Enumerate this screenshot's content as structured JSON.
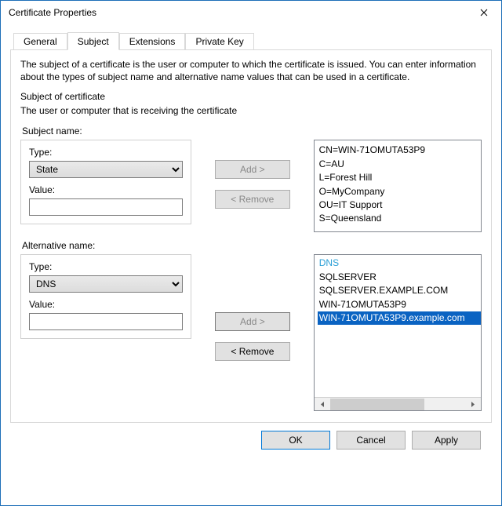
{
  "window": {
    "title": "Certificate Properties"
  },
  "tabs": {
    "general": "General",
    "subject": "Subject",
    "extensions": "Extensions",
    "privateKey": "Private Key"
  },
  "panel": {
    "description": "The subject of a certificate is the user or computer to which the certificate is issued. You can enter information about the types of subject name and alternative name values that can be used in a certificate.",
    "sectionTitle": "Subject of certificate",
    "sectionSub": "The user or computer that is receiving the certificate"
  },
  "subjectName": {
    "groupLabel": "Subject name:",
    "typeLabel": "Type:",
    "typeValue": "State",
    "valueLabel": "Value:",
    "valueValue": "",
    "addLabel": "Add >",
    "removeLabel": "< Remove",
    "list": [
      "CN=WIN-71OMUTA53P9",
      "C=AU",
      "L=Forest Hill",
      "O=MyCompany",
      "OU=IT Support",
      "S=Queensland"
    ]
  },
  "altName": {
    "groupLabel": "Alternative name:",
    "typeLabel": "Type:",
    "typeValue": "DNS",
    "valueLabel": "Value:",
    "valueValue": "",
    "addLabel": "Add >",
    "removeLabel": "< Remove",
    "listHeader": "DNS",
    "list": [
      "SQLSERVER",
      "SQLSERVER.EXAMPLE.COM",
      "WIN-71OMUTA53P9",
      "WIN-71OMUTA53P9.example.com"
    ],
    "selectedIndex": 3
  },
  "footer": {
    "ok": "OK",
    "cancel": "Cancel",
    "apply": "Apply"
  }
}
